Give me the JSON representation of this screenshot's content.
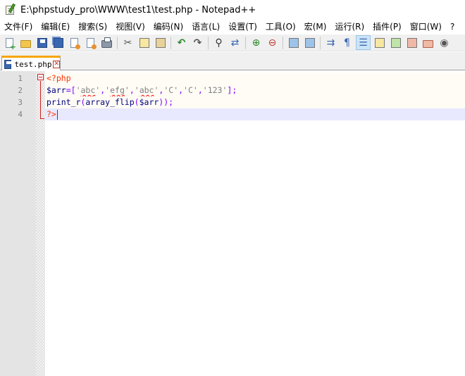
{
  "window": {
    "title": "E:\\phpstudy_pro\\WWW\\test1\\test.php - Notepad++"
  },
  "menu": [
    {
      "name": "menu-file",
      "label": "文件(F)"
    },
    {
      "name": "menu-edit",
      "label": "编辑(E)"
    },
    {
      "name": "menu-search",
      "label": "搜索(S)"
    },
    {
      "name": "menu-view",
      "label": "视图(V)"
    },
    {
      "name": "menu-encoding",
      "label": "编码(N)"
    },
    {
      "name": "menu-language",
      "label": "语言(L)"
    },
    {
      "name": "menu-settings",
      "label": "设置(T)"
    },
    {
      "name": "menu-tools",
      "label": "工具(O)"
    },
    {
      "name": "menu-macro",
      "label": "宏(M)"
    },
    {
      "name": "menu-run",
      "label": "运行(R)"
    },
    {
      "name": "menu-plugins",
      "label": "插件(P)"
    },
    {
      "name": "menu-window",
      "label": "窗口(W)"
    },
    {
      "name": "menu-help",
      "label": "?"
    }
  ],
  "toolbar": {
    "icons": [
      "new-file-icon",
      "open-file-icon",
      "save-icon",
      "save-all-icon",
      "close-icon",
      "close-all-icon",
      "print-icon",
      "cut-icon",
      "copy-icon",
      "paste-icon",
      "undo-icon",
      "redo-icon",
      "find-icon",
      "replace-icon",
      "zoom-in-icon",
      "zoom-out-icon",
      "sync-vertical-icon",
      "sync-horizontal-icon",
      "word-wrap-icon",
      "show-all-chars-icon",
      "indent-guide-icon",
      "user-defined-language-icon",
      "document-map-icon",
      "function-list-icon",
      "folder-as-workspace-icon",
      "monitoring-icon"
    ]
  },
  "tab": {
    "label": "test.php",
    "close_symbol": "✕"
  },
  "editor": {
    "line_numbers": [
      "1",
      "2",
      "3",
      "4"
    ],
    "lines": [
      {
        "tokens": [
          {
            "cls": "c-tag",
            "text": "<?php"
          }
        ]
      },
      {
        "tokens": [
          {
            "cls": "c-var",
            "text": "$arr"
          },
          {
            "cls": "c-op",
            "text": "=["
          },
          {
            "cls": "c-str",
            "text": "'"
          },
          {
            "cls": "c-str squiggle",
            "text": "abc"
          },
          {
            "cls": "c-str",
            "text": "'"
          },
          {
            "cls": "c-op",
            "text": ","
          },
          {
            "cls": "c-str",
            "text": "'"
          },
          {
            "cls": "c-str squiggle",
            "text": "efg"
          },
          {
            "cls": "c-str",
            "text": "'"
          },
          {
            "cls": "c-op",
            "text": ","
          },
          {
            "cls": "c-str",
            "text": "'"
          },
          {
            "cls": "c-str squiggle",
            "text": "abc"
          },
          {
            "cls": "c-str",
            "text": "'"
          },
          {
            "cls": "c-op",
            "text": ","
          },
          {
            "cls": "c-str",
            "text": "'C'"
          },
          {
            "cls": "c-op",
            "text": ","
          },
          {
            "cls": "c-str",
            "text": "'C'"
          },
          {
            "cls": "c-op",
            "text": ","
          },
          {
            "cls": "c-str",
            "text": "'123'"
          },
          {
            "cls": "c-op",
            "text": "];"
          }
        ]
      },
      {
        "tokens": [
          {
            "cls": "c-fn",
            "text": "print_r"
          },
          {
            "cls": "c-op",
            "text": "("
          },
          {
            "cls": "c-fn",
            "text": "array_flip"
          },
          {
            "cls": "c-op",
            "text": "("
          },
          {
            "cls": "c-var",
            "text": "$arr"
          },
          {
            "cls": "c-op",
            "text": "));"
          }
        ]
      },
      {
        "tokens": [
          {
            "cls": "c-tag",
            "text": "?>"
          }
        ]
      }
    ]
  },
  "colors": {
    "tab_accent": "#f7a600",
    "current_line": "#e8e8ff",
    "php_tag": "#ff3300"
  }
}
